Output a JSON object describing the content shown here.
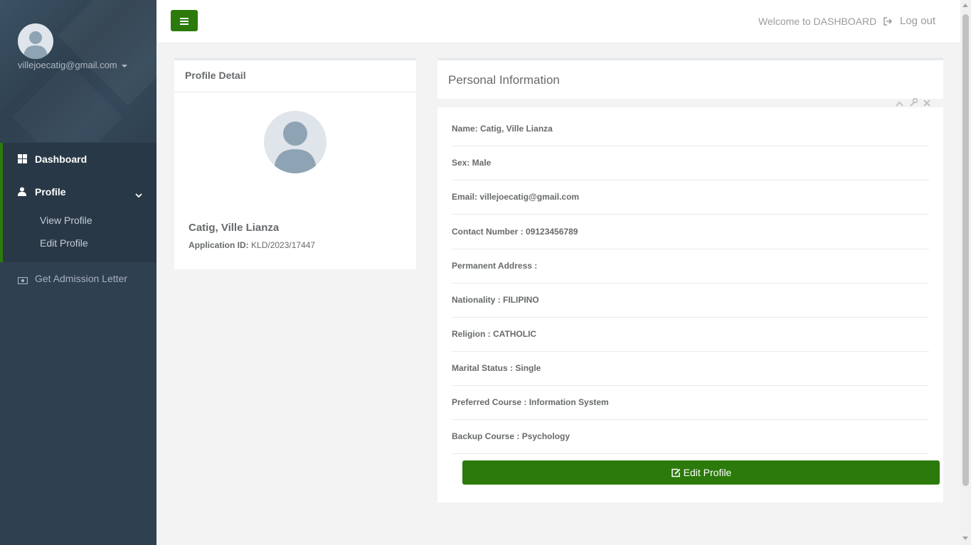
{
  "sidebar": {
    "user_email": "villejoecatig@gmail.com",
    "nav": {
      "dashboard": "Dashboard",
      "profile": "Profile",
      "view_profile": "View Profile",
      "edit_profile": "Edit Profile",
      "admission_letter": "Get Admission Letter"
    }
  },
  "topbar": {
    "welcome": "Welcome to DASHBOARD",
    "logout": "Log out"
  },
  "profile_detail": {
    "title": "Profile Detail",
    "name": "Catig, Ville Lianza",
    "app_id_label": "Application ID:",
    "app_id_value": "KLD/2023/17447"
  },
  "personal_info": {
    "title": "Personal Information",
    "rows": [
      "Name: Catig, Ville Lianza",
      "Sex: Male",
      "Email: villejoecatig@gmail.com",
      "Contact Number : 09123456789",
      "Permanent Address :",
      "Nationality : FILIPINO",
      "Religion : CATHOLIC",
      "Marital Status : Single",
      "Preferred Course : Information System",
      "Backup Course : Psychology"
    ],
    "edit_button": "Edit Profile"
  },
  "icons": {
    "menu": "hamburger-icon",
    "logout": "sign-out-icon",
    "dashboard": "th-large-icon",
    "profile": "user-icon",
    "admission": "money-icon",
    "edit": "edit-icon",
    "collapse": "chevron-up-icon",
    "config": "wrench-icon",
    "close": "times-icon"
  },
  "colors": {
    "sidebar_bg": "#2f4050",
    "accent_green": "#2b7a0b",
    "page_bg": "#f3f3f4"
  }
}
